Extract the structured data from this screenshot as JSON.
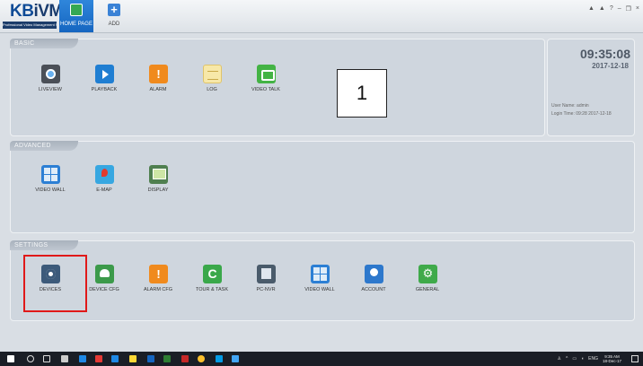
{
  "app": {
    "logo_text_kb": "KB",
    "logo_text_ivms": "iVMS",
    "logo_subtitle": "Professional Video Management System"
  },
  "top_tabs": [
    {
      "label": "HOME PAGE",
      "icon": "home-icon",
      "active": true
    },
    {
      "label": "ADD",
      "icon": "plus-icon",
      "active": false
    }
  ],
  "window_controls": [
    "user-icon",
    "lock-icon",
    "help-icon",
    "minimize-icon",
    "restore-icon",
    "close-icon"
  ],
  "window_controls_text": [
    "▲",
    "▲",
    "?",
    "–",
    "❐",
    "×"
  ],
  "sections": {
    "basic": {
      "title": "BASIC",
      "tiles": [
        {
          "label": "LIVEVIEW",
          "icon": "liveview-icon"
        },
        {
          "label": "PLAYBACK",
          "icon": "playback-icon"
        },
        {
          "label": "ALARM",
          "icon": "alarm-icon"
        },
        {
          "label": "LOG",
          "icon": "log-icon"
        },
        {
          "label": "VIDEO TALK",
          "icon": "video-talk-icon"
        }
      ]
    },
    "advanced": {
      "title": "ADVANCED",
      "tiles": [
        {
          "label": "VIDEO WALL",
          "icon": "video-wall-icon"
        },
        {
          "label": "E-MAP",
          "icon": "emap-icon"
        },
        {
          "label": "DISPLAY",
          "icon": "display-icon"
        }
      ]
    },
    "settings": {
      "title": "SETTINGS",
      "tiles": [
        {
          "label": "DEVICES",
          "icon": "devices-icon",
          "highlighted": true
        },
        {
          "label": "DEVICE CFG",
          "icon": "device-cfg-icon"
        },
        {
          "label": "ALARM CFG",
          "icon": "alarm-cfg-icon"
        },
        {
          "label": "TOUR & TASK",
          "icon": "tour-task-icon"
        },
        {
          "label": "PC-NVR",
          "icon": "pc-nvr-icon"
        },
        {
          "label": "VIDEO WALL",
          "icon": "video-wall-settings-icon"
        },
        {
          "label": "ACCOUNT",
          "icon": "account-icon"
        },
        {
          "label": "GENERAL",
          "icon": "general-icon"
        }
      ]
    }
  },
  "clock": {
    "time": "09:35:08",
    "date": "2017-12-18",
    "user_line": "User Name: admin",
    "login_line": "Login Time: 09:28 2017-12-18"
  },
  "annotation": {
    "callout_number": "1",
    "highlight_color": "#e01919"
  },
  "taskbar": {
    "lang": "ENG",
    "time": "9:35 AM",
    "date": "18-Dec-17"
  },
  "colors": {
    "accent": "#1565c0",
    "panel_bg": "#cfd6de",
    "page_bg": "#d9dee4",
    "taskbar_bg": "#1a1e26"
  }
}
